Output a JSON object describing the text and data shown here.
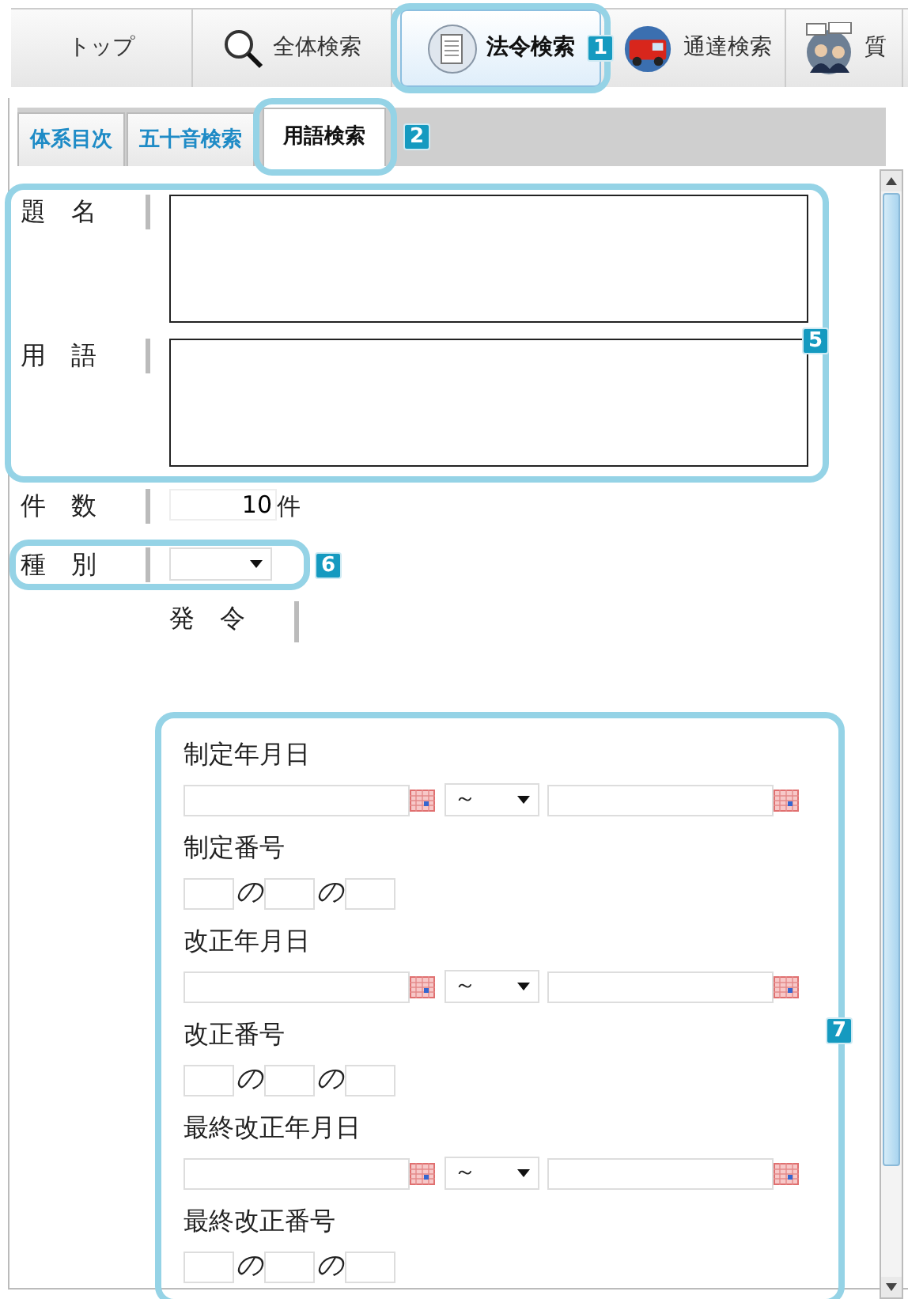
{
  "top_tabs": [
    {
      "label": "トップ",
      "kind": "plain",
      "selected": false
    },
    {
      "label": "全体検索",
      "kind": "search",
      "selected": false
    },
    {
      "label": "法令検索",
      "kind": "laws",
      "selected": true,
      "callout": "1"
    },
    {
      "label": "通達検索",
      "kind": "notices",
      "selected": false
    },
    {
      "label": "質",
      "kind": "qa",
      "selected": false
    }
  ],
  "sub_tabs": [
    {
      "label": "体系目次",
      "selected": false
    },
    {
      "label": "五十音検索",
      "selected": false
    },
    {
      "label": "用語検索",
      "selected": true,
      "callout": "2"
    }
  ],
  "text_fields": {
    "callout": "5",
    "fields": [
      {
        "label": "題　名"
      },
      {
        "label": "用　語"
      }
    ]
  },
  "count": {
    "label": "件　数",
    "value": "10",
    "unit": "件"
  },
  "type_select": {
    "label": "種　別",
    "callout": "6"
  },
  "issue": {
    "label": "発　令"
  },
  "date_block": {
    "callout": "7",
    "sections": [
      {
        "label": "制定年月日",
        "kind": "date_range",
        "separator": "～"
      },
      {
        "label": "制定番号",
        "kind": "number",
        "joiners": [
          "の",
          "の"
        ]
      },
      {
        "label": "改正年月日",
        "kind": "date_range",
        "separator": "～"
      },
      {
        "label": "改正番号",
        "kind": "number",
        "joiners": [
          "の",
          "の"
        ]
      },
      {
        "label": "最終改正年月日",
        "kind": "date_range",
        "separator": "～"
      },
      {
        "label": "最終改正番号",
        "kind": "number",
        "joiners": [
          "の",
          "の"
        ]
      }
    ]
  }
}
